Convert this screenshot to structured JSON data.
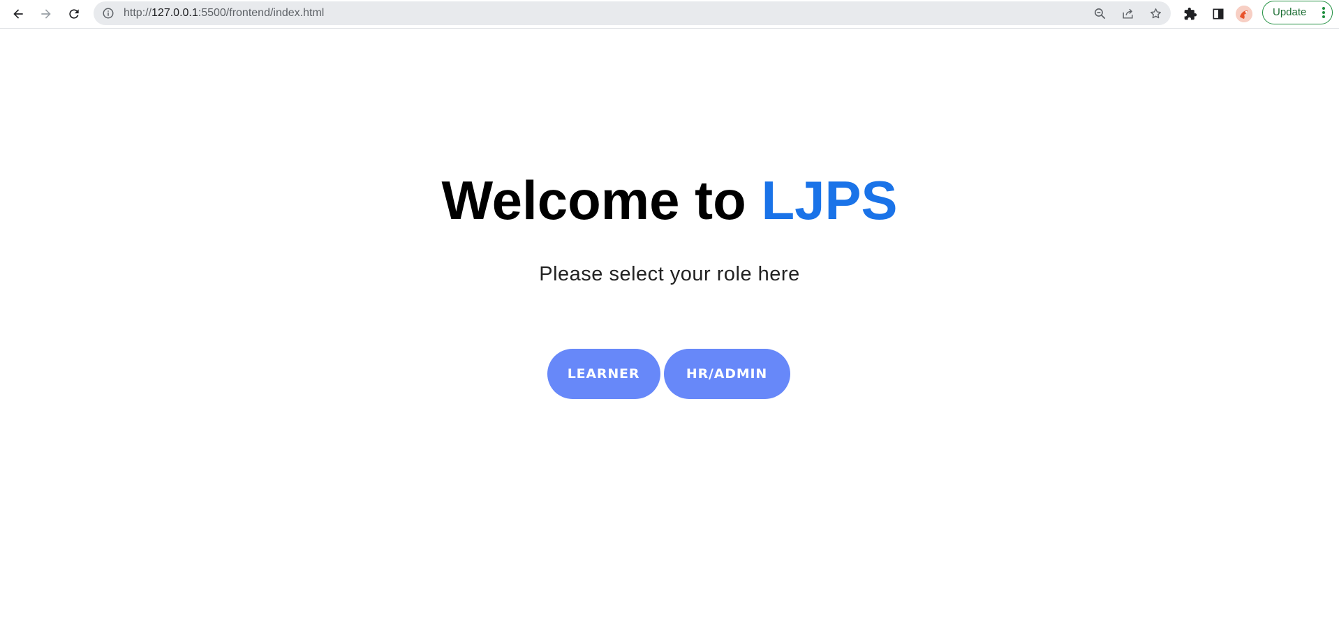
{
  "browser": {
    "url_prefix": "http://",
    "url_host": "127.0.0.1",
    "url_rest": ":5500/frontend/index.html",
    "update_label": "Update",
    "icons": [
      "back-icon",
      "forward-icon",
      "reload-icon",
      "info-icon",
      "zoom-out-icon",
      "share-icon",
      "star-icon",
      "extensions-icon",
      "side-panel-icon",
      "more-icon"
    ]
  },
  "page": {
    "heading_prefix": "Welcome to ",
    "heading_brand": "LJPS",
    "subtitle": "Please select your role here",
    "roles": {
      "learner_label": "LEARNER",
      "admin_label": "HR/ADMIN"
    }
  },
  "colors": {
    "brand": "#1a73e8",
    "button": "#6788f9",
    "update_border": "#1e8e3e"
  }
}
